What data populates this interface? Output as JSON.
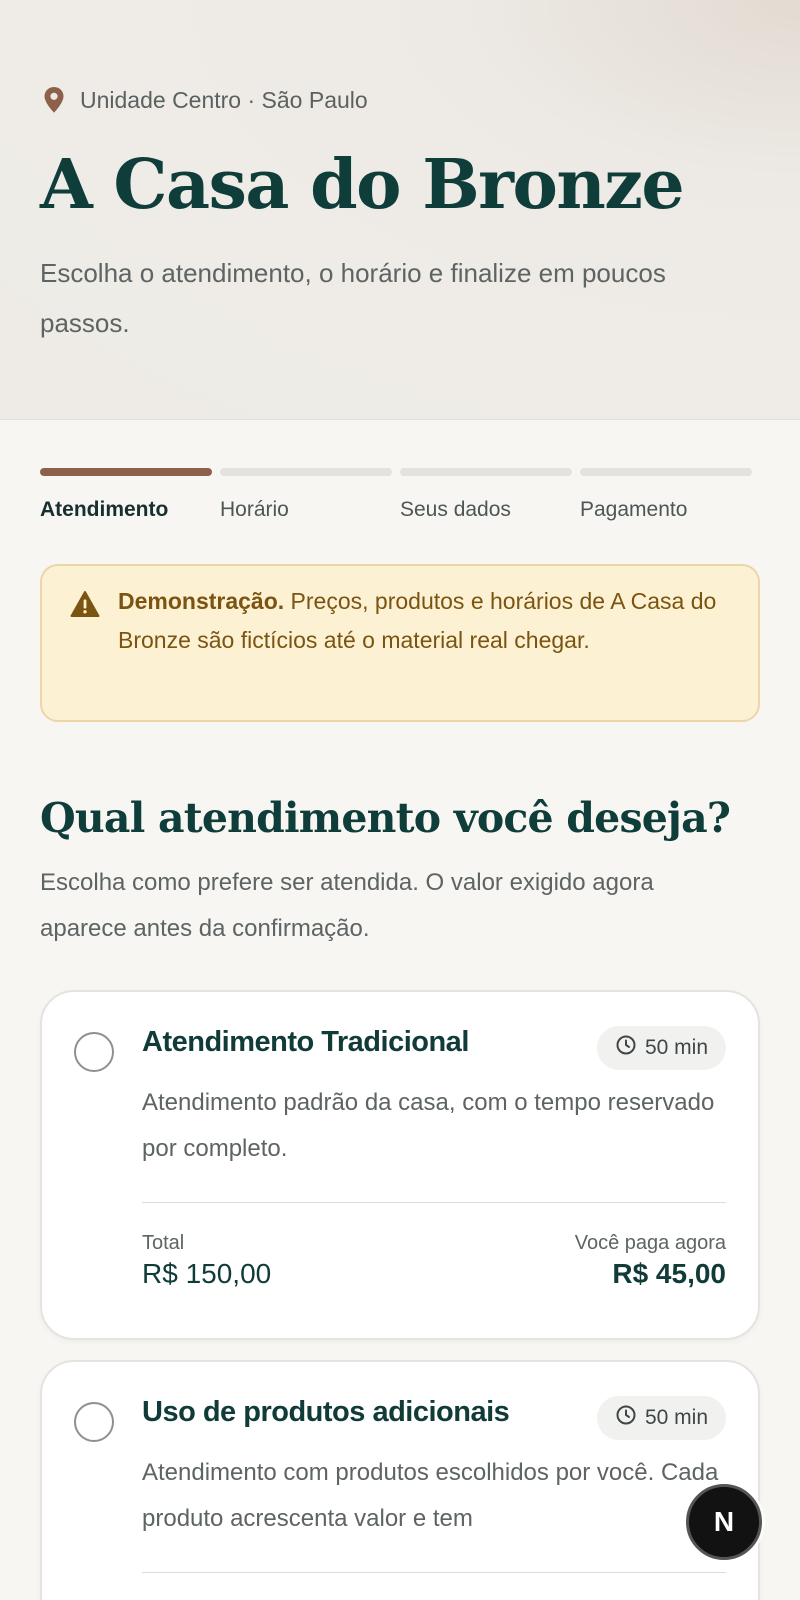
{
  "header": {
    "location": "Unidade Centro · São Paulo",
    "title": "A Casa do Bronze",
    "subtitle": "Escolha o atendimento, o horário e finalize em poucos passos."
  },
  "steps": [
    {
      "label": "Atendimento",
      "active": true
    },
    {
      "label": "Horário",
      "active": false
    },
    {
      "label": "Seus dados",
      "active": false
    },
    {
      "label": "Pagamento",
      "active": false
    }
  ],
  "notice": {
    "strong": "Demonstração.",
    "text": " Preços, produtos e horários de A Casa do Bronze são fictícios até o material real chegar."
  },
  "section": {
    "title": "Qual atendimento você deseja?",
    "subtitle": "Escolha como prefere ser atendida. O valor exigido agora aparece antes da confirmação."
  },
  "services": [
    {
      "name": "Atendimento Tradicional",
      "duration": "50 min",
      "description": "Atendimento padrão da casa, com o tempo reservado por completo.",
      "total_label": "Total",
      "total": "R$ 150,00",
      "pay_now_label": "Você paga agora",
      "pay_now": "R$ 45,00"
    },
    {
      "name": "Uso de produtos adicionais",
      "duration": "50 min",
      "description": "Atendimento com produtos escolhidos por você. Cada produto acrescenta valor e tem"
    }
  ],
  "dev_badge": "N",
  "colors": {
    "accent": "#8c6049",
    "heading": "#0f3d3a",
    "notice_bg": "#fdf1d4",
    "notice_text": "#7a5410"
  }
}
